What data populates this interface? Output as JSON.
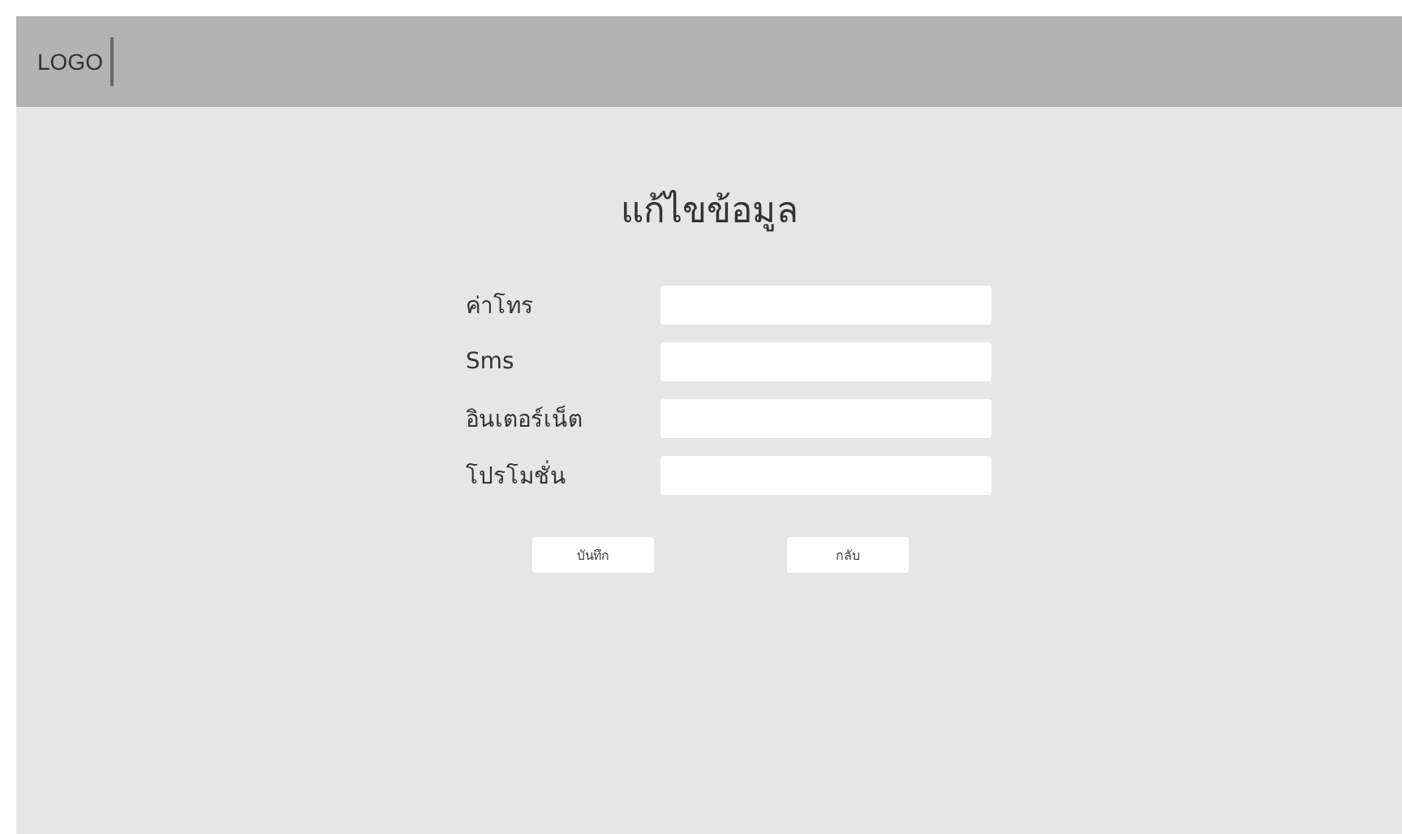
{
  "header": {
    "logo": "LOGO"
  },
  "title": "แก้ไขข้อมูล",
  "fields": [
    {
      "label": "ค่าโทร"
    },
    {
      "label": "Sms"
    },
    {
      "label": "อินเตอร์เน็ต"
    },
    {
      "label": "โปรโมชั่น"
    }
  ],
  "buttons": [
    "บันทึก",
    "กลับ"
  ]
}
